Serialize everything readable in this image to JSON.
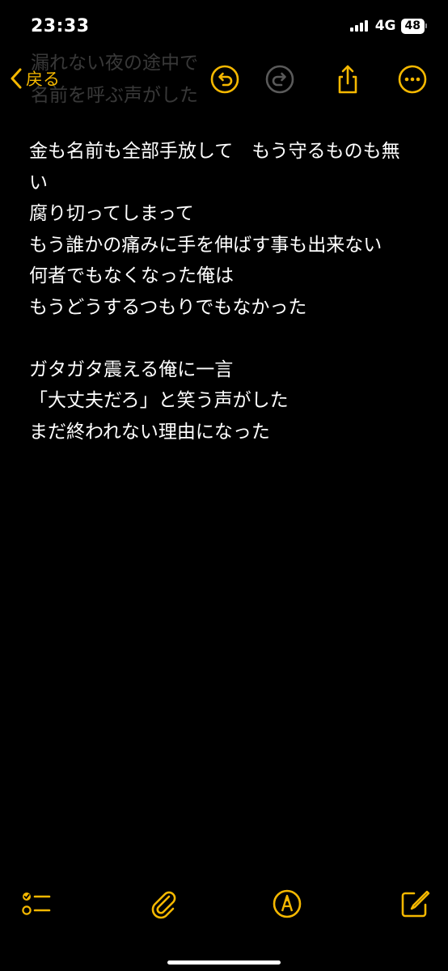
{
  "status_bar": {
    "time": "23:33",
    "network": "4G",
    "battery": "48"
  },
  "ghost_text": {
    "line1": "漏れない夜の途中で",
    "line2": "名前を呼ぶ声がした"
  },
  "nav": {
    "back_label": "戻る",
    "accent_color": "#f5b800"
  },
  "note": {
    "lines": [
      "金も名前も全部手放して　もう守るものも無",
      "い",
      "腐り切ってしまって",
      "もう誰かの痛みに手を伸ばす事も出来ない",
      "何者でもなくなった俺は",
      "もうどうするつもりでもなかった",
      "",
      "ガタガタ震える俺に一言",
      "「大丈夫だろ」と笑う声がした",
      "まだ終われない理由になった"
    ]
  },
  "icons": {
    "back": "chevron-left-icon",
    "undo": "undo-icon",
    "redo": "redo-icon",
    "share": "share-icon",
    "more": "more-icon",
    "checklist": "checklist-icon",
    "attachment": "paperclip-icon",
    "markup": "markup-pen-icon",
    "compose": "compose-icon"
  }
}
